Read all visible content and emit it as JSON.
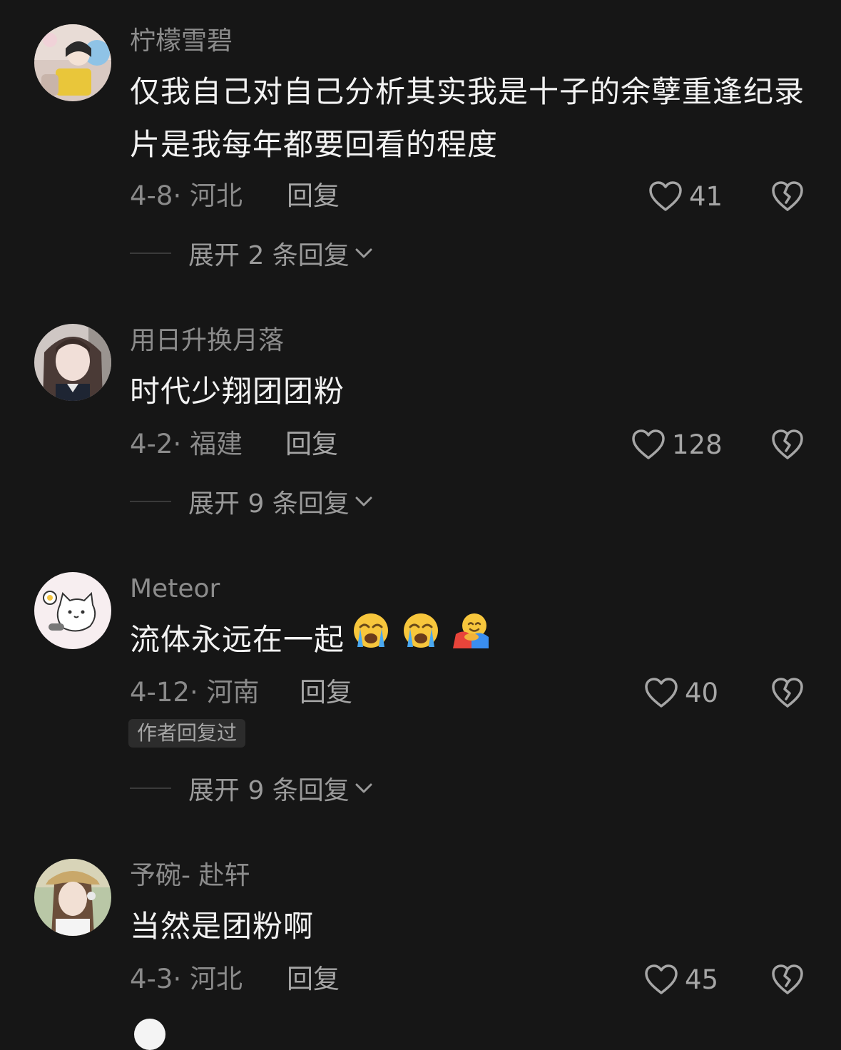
{
  "comments": [
    {
      "username": "柠檬雪碧",
      "text": "仅我自己对自己分析其实我是十子的余孽重逢纪录片是我每年都要回看的程度",
      "date": "4-8",
      "location": "河北",
      "reply_label": "回复",
      "likes": "41",
      "expand_label": "展开 2 条回复"
    },
    {
      "username": "用日升换月落",
      "text": "时代少翔团团粉",
      "date": "4-2",
      "location": "福建",
      "reply_label": "回复",
      "likes": "128",
      "expand_label": "展开 9 条回复"
    },
    {
      "username": "Meteor",
      "text": "流体永远在一起",
      "emojis": [
        "loudly-crying-face",
        "loudly-crying-face",
        "hugging-face"
      ],
      "date": "4-12",
      "location": "河南",
      "reply_label": "回复",
      "likes": "40",
      "badge": "作者回复过",
      "expand_label": "展开 9 条回复"
    },
    {
      "username": "予碗- 赴轩",
      "text": "当然是团粉啊",
      "date": "4-3",
      "location": "河北",
      "reply_label": "回复",
      "likes": "45"
    }
  ],
  "meta_separator": "·",
  "icons": {
    "like": "heart-outline-icon",
    "dislike": "broken-heart-icon",
    "expand": "chevron-down-icon"
  },
  "colors": {
    "background": "#161616",
    "text_primary": "#f2f2f2",
    "text_secondary": "#8c8c8c"
  }
}
